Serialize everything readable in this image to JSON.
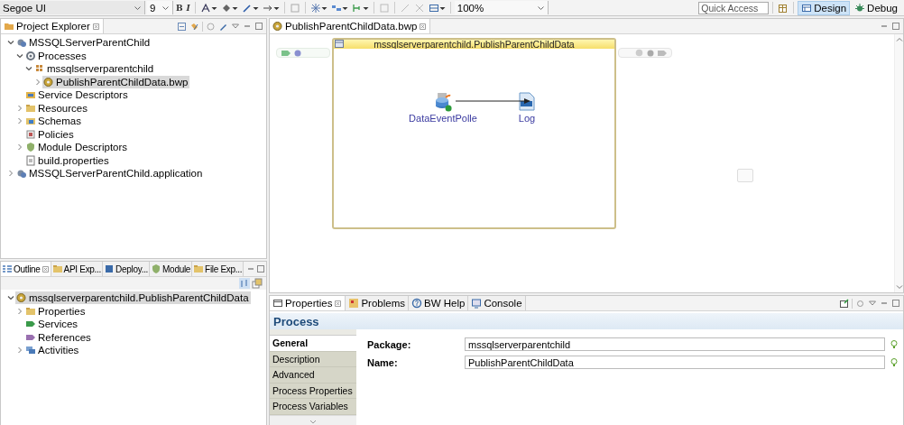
{
  "toolbar": {
    "font": "Segoe UI",
    "font_size": "9",
    "format_buttons": [
      "B",
      "I"
    ],
    "zoom": "100%",
    "quick_access": {
      "placeholder": "Quick Access"
    },
    "perspectives": [
      {
        "label": "Design",
        "selected": true
      },
      {
        "label": "Debug",
        "selected": false
      }
    ]
  },
  "project_explorer": {
    "title": "Project Explorer",
    "tree": [
      {
        "label": "MSSQLServerParentChild",
        "kind": "project",
        "expanded": true,
        "selected": false,
        "children": [
          {
            "label": "Processes",
            "kind": "processes",
            "expanded": true,
            "selected": false,
            "children": [
              {
                "label": "mssqlserverparentchild",
                "kind": "package",
                "expanded": true,
                "selected": false,
                "children": [
                  {
                    "label": "PublishParentChildData.bwp",
                    "kind": "process",
                    "expanded": false,
                    "selected": true
                  }
                ]
              }
            ]
          },
          {
            "label": "Service Descriptors",
            "kind": "service",
            "selected": false
          },
          {
            "label": "Resources",
            "kind": "resources",
            "expanded": false,
            "selected": false
          },
          {
            "label": "Schemas",
            "kind": "schemas",
            "expanded": false,
            "selected": false
          },
          {
            "label": "Policies",
            "kind": "policies",
            "selected": false
          },
          {
            "label": "Module Descriptors",
            "kind": "module",
            "expanded": false,
            "selected": false
          },
          {
            "label": "build.properties",
            "kind": "file",
            "selected": false
          }
        ]
      },
      {
        "label": "MSSQLServerParentChild.application",
        "kind": "project",
        "expanded": false,
        "selected": false
      }
    ]
  },
  "outline": {
    "tabs": [
      {
        "label": "Outline",
        "kind": "outline",
        "selected": true
      },
      {
        "label": "API Exp...",
        "kind": "folder",
        "selected": false
      },
      {
        "label": "Deploy...",
        "kind": "deploy",
        "selected": false
      },
      {
        "label": "Module",
        "kind": "module",
        "selected": false
      },
      {
        "label": "File Exp...",
        "kind": "folder",
        "selected": false
      }
    ],
    "tree": [
      {
        "label": "mssqlserverparentchild.PublishParentChildData",
        "kind": "process",
        "expanded": true,
        "selected": true,
        "children": [
          {
            "label": "Properties",
            "kind": "resources",
            "expanded": false,
            "selected": false
          },
          {
            "label": "Services",
            "kind": "service_tag",
            "selected": false
          },
          {
            "label": "References",
            "kind": "reference_tag",
            "selected": false
          },
          {
            "label": "Activities",
            "kind": "activities",
            "expanded": false,
            "selected": false
          }
        ]
      }
    ]
  },
  "editor": {
    "tab": "PublishParentChildData.bwp",
    "process": {
      "title": "mssqlserverparentchild.PublishParentChildData",
      "activities": [
        {
          "label": "DataEventPolle",
          "kind": "database"
        },
        {
          "label": "Log",
          "kind": "log"
        }
      ]
    }
  },
  "properties": {
    "tabs": [
      {
        "label": "Properties",
        "kind": "properties",
        "selected": true
      },
      {
        "label": "Problems",
        "kind": "problems",
        "selected": false
      },
      {
        "label": "BW Help",
        "kind": "help",
        "selected": false
      },
      {
        "label": "Console",
        "kind": "console",
        "selected": false
      }
    ],
    "heading": "Process",
    "sections": [
      {
        "label": "General",
        "selected": true
      },
      {
        "label": "Description",
        "selected": false
      },
      {
        "label": "Advanced",
        "selected": false
      },
      {
        "label": "Process Properties",
        "selected": false
      },
      {
        "label": "Process Variables",
        "selected": false
      }
    ],
    "fields": [
      {
        "label": "Package:",
        "value": "mssqlserverparentchild"
      },
      {
        "label": "Name:",
        "value": "PublishParentChildData"
      }
    ]
  }
}
